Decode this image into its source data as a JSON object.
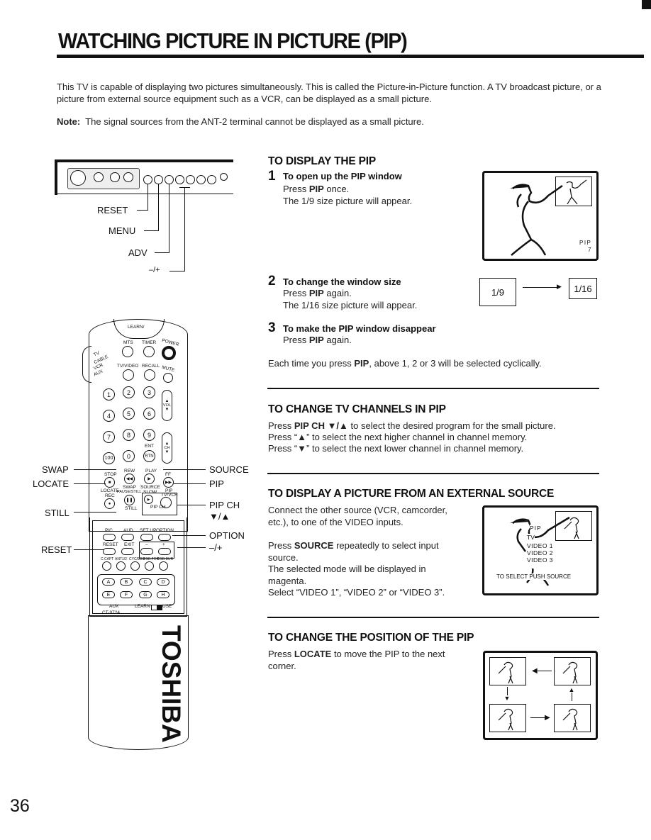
{
  "page": {
    "title": "WATCHING PICTURE IN PICTURE (PIP)",
    "intro": "This TV is capable of displaying two pictures simultaneously. This is called the Picture-in-Picture function. A TV broadcast picture, or a picture from external source equipment such as a VCR, can be displayed as a small picture.",
    "note_label": "Note:",
    "note_text": "The signal sources from the ANT-2 terminal cannot be displayed as a small picture.",
    "page_number": "36"
  },
  "tv_panel": {
    "labels": [
      "RESET",
      "MENU",
      "ADV",
      "–/+"
    ]
  },
  "remote": {
    "learn_label": "LEARN/",
    "mode_labels": [
      "TV",
      "CABLE",
      "VCR",
      "AUX"
    ],
    "top_buttons": [
      "MTS",
      "TIMER",
      "POWER",
      "TV/VIDEO",
      "RECALL",
      "MUTE"
    ],
    "digits": [
      "1",
      "2",
      "3",
      "4",
      "5",
      "6",
      "7",
      "8",
      "9",
      "100",
      "0",
      "RTN"
    ],
    "ent_label": "ENT",
    "vol_label": "VOL",
    "ch_label": "CH",
    "transport": [
      "STOP",
      "REW",
      "PLAY",
      "FF",
      "REC",
      "PAUSE/STILL",
      "SLOW",
      "TV/VCR"
    ],
    "transport_sub": [
      "LOCATE",
      "SWAP",
      "SOURCE",
      "PIP",
      "STILL",
      "PIP CH"
    ],
    "menu_buttons": [
      "PIC",
      "AUD",
      "SET UP",
      "OPTION",
      "RESET",
      "EXIT",
      "–",
      "+"
    ],
    "row5": [
      "C.CAPT",
      "ANT1/2",
      "CYC/EBS",
      "DSB.FOR",
      "DSB.BUR"
    ],
    "aux_buttons": [
      "A",
      "B",
      "C",
      "D",
      "E",
      "F",
      "G",
      "H"
    ],
    "aux_label": "AUX",
    "learn_use": [
      "LEARN",
      "USE"
    ],
    "model": "CT-9724",
    "brand": "TOSHIBA",
    "callouts_left": [
      "SWAP",
      "LOCATE",
      "STILL",
      "RESET"
    ],
    "callouts_right": [
      "SOURCE",
      "PIP",
      "PIP CH",
      "▼/▲",
      "OPTION",
      "–/+"
    ]
  },
  "sections": {
    "display": {
      "heading": "TO DISPLAY THE PIP",
      "steps": [
        {
          "num": "1",
          "title": "To open up the PIP window",
          "lines_pre": "Press ",
          "bold": "PIP",
          "lines_post": " once.",
          "line2": "The 1/9 size picture will appear."
        },
        {
          "num": "2",
          "title": "To change the window size",
          "lines_pre": "Press ",
          "bold": "PIP",
          "lines_post": " again.",
          "line2": "The 1/16 size picture will appear."
        },
        {
          "num": "3",
          "title": "To make the PIP window disappear",
          "lines_pre": "Press ",
          "bold": "PIP",
          "lines_post": " again.",
          "line2": ""
        }
      ],
      "tv_osd": [
        "PIP",
        "7"
      ],
      "size_from": "1/9",
      "size_to": "1/16",
      "cycle_pre": "Each time you press ",
      "cycle_bold": "PIP",
      "cycle_post": ", above 1, 2 or 3 will be selected cyclically."
    },
    "channels": {
      "heading": "TO CHANGE TV CHANNELS IN PIP",
      "line1_pre": "Press ",
      "line1_bold": "PIP CH ▼/▲",
      "line1_post": " to select the desired program for the small picture.",
      "line2": "Press “▲” to select the next higher channel in channel memory.",
      "line3": "Press “▼” to select the next lower channel in channel memory."
    },
    "external": {
      "heading": "TO DISPLAY A PICTURE FROM AN EXTERNAL SOURCE",
      "p1": "Connect the other source (VCR, camcorder, etc.), to one of the VIDEO inputs.",
      "p2_pre": "Press ",
      "p2_bold": "SOURCE",
      "p2_post": " repeatedly to select input source.",
      "p3": "The selected mode will be displayed in magenta.",
      "p4": "Select “VIDEO 1”, “VIDEO 2” or “VIDEO 3”.",
      "osd": [
        "PIP",
        "TV",
        "VIDEO 1",
        "VIDEO 2",
        "VIDEO 3",
        "TO SELECT PUSH SOURCE"
      ]
    },
    "position": {
      "heading": "TO CHANGE THE POSITION OF THE PIP",
      "p_pre": "Press ",
      "p_bold": "LOCATE",
      "p_post": " to move the PIP to the next corner."
    }
  }
}
